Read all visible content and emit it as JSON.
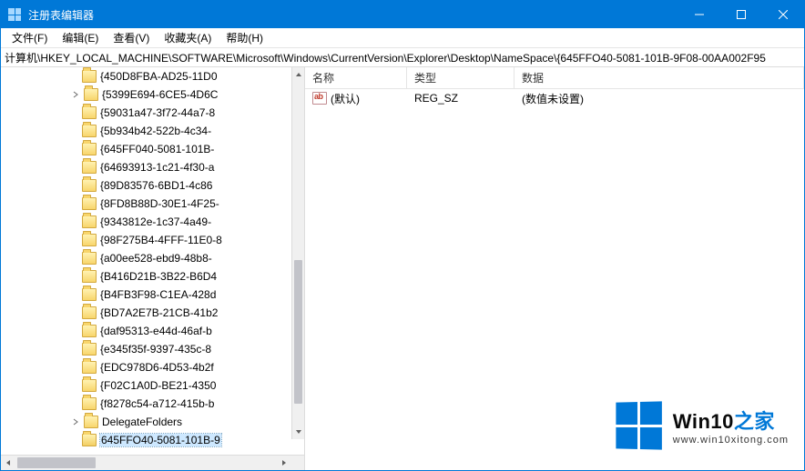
{
  "titlebar": {
    "title": "注册表编辑器"
  },
  "menu": {
    "file": "文件(F)",
    "edit": "编辑(E)",
    "view": "查看(V)",
    "fav": "收藏夹(A)",
    "help": "帮助(H)"
  },
  "address": "计算机\\HKEY_LOCAL_MACHINE\\SOFTWARE\\Microsoft\\Windows\\CurrentVersion\\Explorer\\Desktop\\NameSpace\\{645FFO40-5081-101B-9F08-00AA002F95",
  "tree": {
    "items": [
      {
        "label": "{450D8FBA-AD25-11D0",
        "indent": 5,
        "expandable": false
      },
      {
        "label": "{5399E694-6CE5-4D6C",
        "indent": 5,
        "expandable": true
      },
      {
        "label": "{59031a47-3f72-44a7-8",
        "indent": 5,
        "expandable": false
      },
      {
        "label": "{5b934b42-522b-4c34-",
        "indent": 5,
        "expandable": false
      },
      {
        "label": "{645FF040-5081-101B-",
        "indent": 5,
        "expandable": false
      },
      {
        "label": "{64693913-1c21-4f30-a",
        "indent": 5,
        "expandable": false
      },
      {
        "label": "{89D83576-6BD1-4c86",
        "indent": 5,
        "expandable": false
      },
      {
        "label": "{8FD8B88D-30E1-4F25-",
        "indent": 5,
        "expandable": false
      },
      {
        "label": "{9343812e-1c37-4a49-",
        "indent": 5,
        "expandable": false
      },
      {
        "label": "{98F275B4-4FFF-11E0-8",
        "indent": 5,
        "expandable": false
      },
      {
        "label": "{a00ee528-ebd9-48b8-",
        "indent": 5,
        "expandable": false
      },
      {
        "label": "{B416D21B-3B22-B6D4",
        "indent": 5,
        "expandable": false
      },
      {
        "label": "{B4FB3F98-C1EA-428d",
        "indent": 5,
        "expandable": false
      },
      {
        "label": "{BD7A2E7B-21CB-41b2",
        "indent": 5,
        "expandable": false
      },
      {
        "label": "{daf95313-e44d-46af-b",
        "indent": 5,
        "expandable": false
      },
      {
        "label": "{e345f35f-9397-435c-8",
        "indent": 5,
        "expandable": false
      },
      {
        "label": "{EDC978D6-4D53-4b2f",
        "indent": 5,
        "expandable": false
      },
      {
        "label": "{F02C1A0D-BE21-4350",
        "indent": 5,
        "expandable": false
      },
      {
        "label": "{f8278c54-a712-415b-b",
        "indent": 5,
        "expandable": false
      },
      {
        "label": "DelegateFolders",
        "indent": 5,
        "expandable": true
      },
      {
        "label": "645FFO40-5081-101B-9",
        "indent": 5,
        "expandable": false,
        "selected": true,
        "open": true
      }
    ]
  },
  "list": {
    "headers": {
      "name": "名称",
      "type": "类型",
      "data": "数据"
    },
    "rows": [
      {
        "name": "(默认)",
        "type": "REG_SZ",
        "data": "(数值未设置)"
      }
    ]
  },
  "watermark": {
    "brand_pre": "Win10",
    "brand_post": "之家",
    "url": "www.win10xitong.com"
  }
}
